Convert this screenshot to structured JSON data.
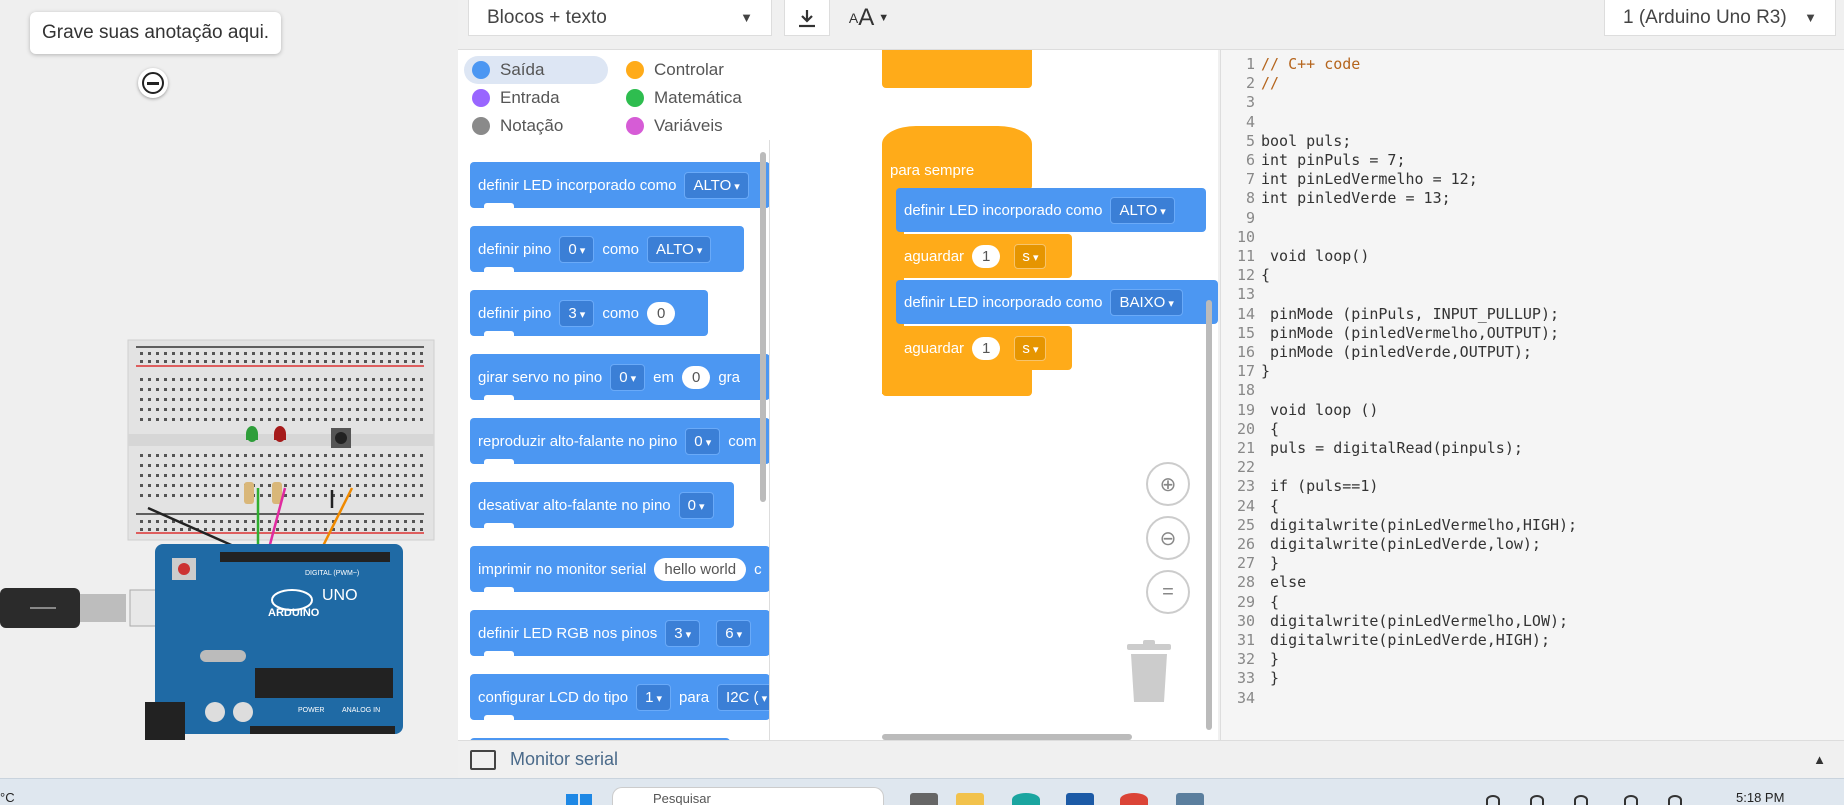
{
  "note": {
    "text": "Grave suas anotação aqui."
  },
  "toolbar": {
    "mode_select": "Blocos + texto",
    "font_label": "A",
    "board_select": "1 (Arduino Uno R3)"
  },
  "categories": [
    {
      "label": "Saída",
      "color": "#4c97f2",
      "selected": true
    },
    {
      "label": "Controlar",
      "color": "#ffab19",
      "selected": false
    },
    {
      "label": "Entrada",
      "color": "#9966ff",
      "selected": false
    },
    {
      "label": "Matemática",
      "color": "#2ebd4f",
      "selected": false
    },
    {
      "label": "Notação",
      "color": "#8a8a8a",
      "selected": false
    },
    {
      "label": "Variáveis",
      "color": "#d65cd6",
      "selected": false
    }
  ],
  "palette": {
    "b1": {
      "text": "definir LED incorporado como",
      "drop": "ALTO"
    },
    "b2": {
      "text": "definir pino",
      "drop1": "0",
      "mid": "como",
      "drop2": "ALTO"
    },
    "b3": {
      "text": "definir pino",
      "drop1": "3",
      "mid": "como",
      "num": "0"
    },
    "b4": {
      "text": "girar servo no pino",
      "drop1": "0",
      "mid": "em",
      "num": "0",
      "tail": "gra"
    },
    "b5": {
      "text": "reproduzir alto-falante no pino",
      "drop1": "0",
      "tail": "com"
    },
    "b6": {
      "text": "desativar alto-falante no pino",
      "drop1": "0"
    },
    "b7": {
      "text": "imprimir no monitor serial",
      "num": "hello world",
      "tail": "c"
    },
    "b8": {
      "text": "definir LED RGB nos pinos",
      "drop1": "3",
      "drop2": "6"
    },
    "b9": {
      "text": "configurar LCD do tipo",
      "drop1": "1",
      "mid": "para",
      "drop2": "I2C ("
    }
  },
  "workspace": {
    "forever": "para sempre",
    "set_led_1": {
      "text": "definir LED incorporado como",
      "value": "ALTO"
    },
    "wait_1": {
      "text": "aguardar",
      "num": "1",
      "unit": "s"
    },
    "set_led_2": {
      "text": "definir LED incorporado como",
      "value": "BAIXO"
    },
    "wait_2": {
      "text": "aguardar",
      "num": "1",
      "unit": "s"
    }
  },
  "code_lines": [
    "// C++ code",
    "//",
    "",
    "",
    "bool puls;",
    "int pinPuls = 7;",
    "int pinLedVermelho = 12;",
    "int pinledVerde = 13;",
    "",
    "",
    " void loop()",
    "{",
    "",
    " pinMode (pinPuls, INPUT_PULLUP);",
    " pinMode (pinledVermelho,OUTPUT);",
    " pinMode (pinledVerde,OUTPUT);",
    "}",
    "",
    " void loop ()",
    " {",
    " puls = digitalRead(pinpuls);",
    "",
    " if (puls==1)",
    " {",
    " digitalwrite(pinLedVermelho,HIGH);",
    " digitalwrite(pinLedVerde,low);",
    " }",
    " else",
    " {",
    " digitalwrite(pinLedVermelho,LOW);",
    " digitalwrite(pinLedVerde,HIGH);",
    " }",
    " }",
    ""
  ],
  "serial_monitor": {
    "label": "Monitor serial"
  },
  "board": {
    "brand": "ARDUINO",
    "model": "UNO",
    "digital": "DIGITAL (PWM~)",
    "power": "POWER",
    "analog": "ANALOG IN"
  },
  "taskbar": {
    "temp": "°C",
    "search": "Pesquisar",
    "time": "5:18 PM"
  }
}
